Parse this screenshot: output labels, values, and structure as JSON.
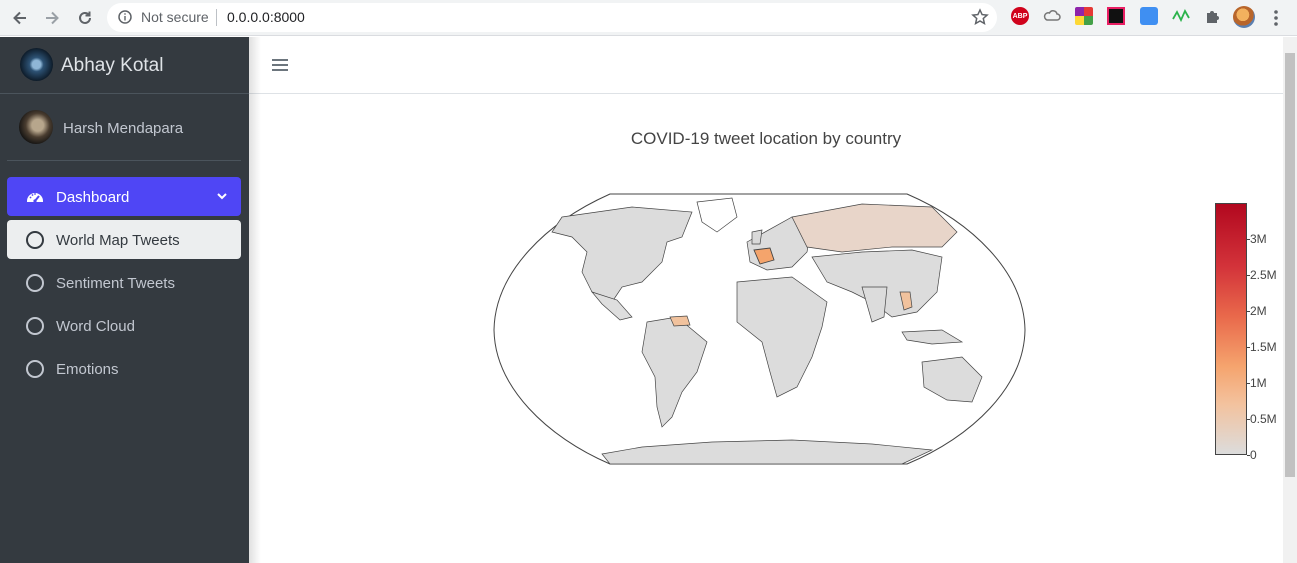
{
  "browser": {
    "security_label": "Not secure",
    "url": "0.0.0.0:8000",
    "abp_label": "ABP"
  },
  "sidebar": {
    "brand": "Abhay Kotal",
    "user_name": "Harsh Mendapara",
    "items": [
      {
        "label": "Dashboard",
        "icon": "tachometer-icon"
      },
      {
        "label": "World Map Tweets",
        "icon": "circle-icon"
      },
      {
        "label": "Sentiment Tweets",
        "icon": "circle-icon"
      },
      {
        "label": "Word Cloud",
        "icon": "circle-icon"
      },
      {
        "label": "Emotions",
        "icon": "circle-icon"
      }
    ]
  },
  "chart_data": {
    "type": "choropleth",
    "title": "COVID-19 tweet location by country",
    "colorscale": [
      "#dcdcdc",
      "#f3c29e",
      "#f5a46e",
      "#e9694b",
      "#d3333a",
      "#b2081f"
    ],
    "colorbar_ticks": [
      "0",
      "0.5M",
      "1M",
      "1.5M",
      "2M",
      "2.5M",
      "3M"
    ],
    "colorbar_range": [
      0,
      3500000
    ]
  }
}
